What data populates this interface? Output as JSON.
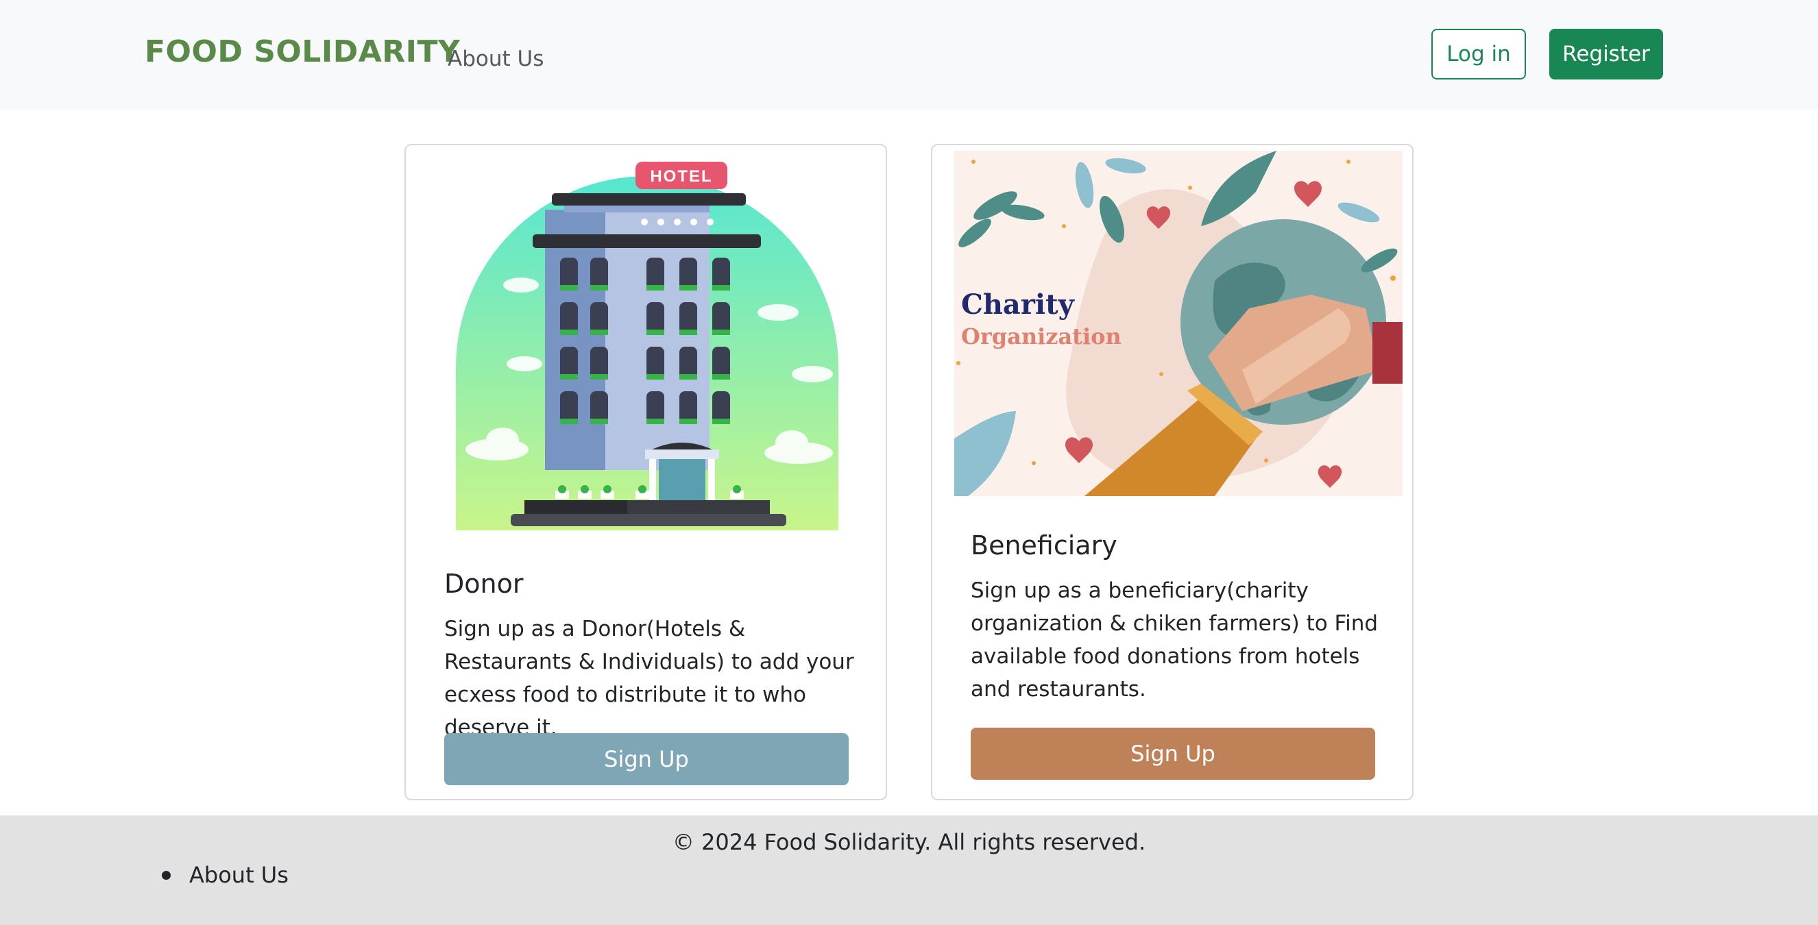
{
  "navbar": {
    "brand": "FOOD SOLIDARITY",
    "about_link": "About Us",
    "login_label": "Log in",
    "register_label": "Register"
  },
  "cards": [
    {
      "title": "Donor",
      "text": "Sign up as a Donor(Hotels & Restaurants & Individuals) to add your ecxess food to distribute it to who deserve it.",
      "button": "Sign Up",
      "image_sign": "HOTEL"
    },
    {
      "title": "Beneficiary",
      "text": "Sign up as a beneficiary(charity organization & chiken farmers) to Find available food donations from hotels and restaurants.",
      "button": "Sign Up",
      "image_title_1": "Charity",
      "image_title_2": "Organization"
    }
  ],
  "footer": {
    "copyright": "© 2024 Food Solidarity. All rights reserved.",
    "links": [
      "About Us"
    ]
  },
  "colors": {
    "brand": "#5a8a47",
    "primary": "#198754",
    "donor_button": "#7fa6b4",
    "beneficiary_button": "#bf8258"
  }
}
